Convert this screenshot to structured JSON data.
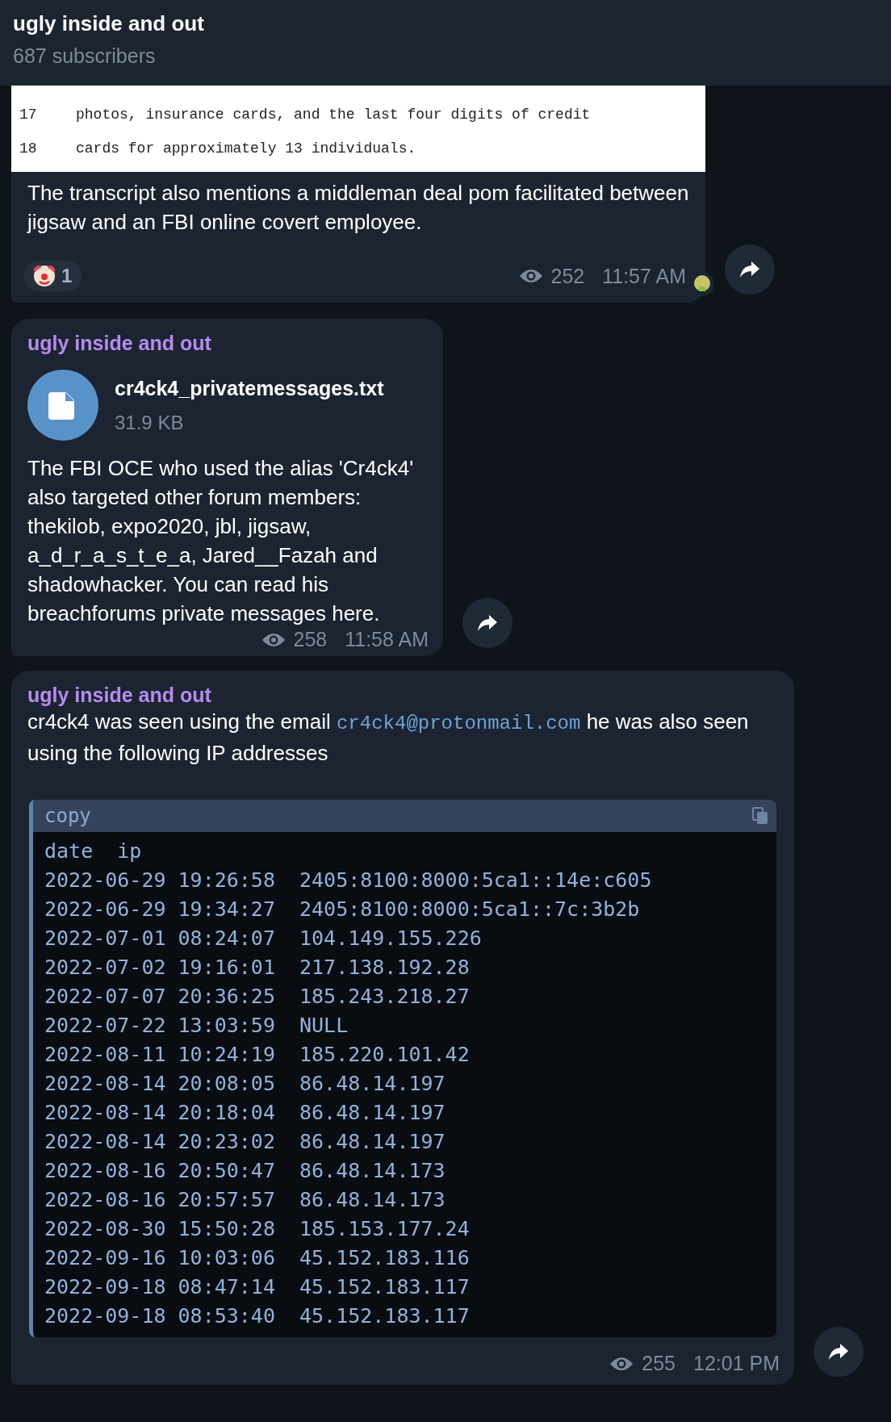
{
  "header": {
    "title": "ugly inside and out",
    "subtitle": "687 subscribers"
  },
  "messages": [
    {
      "kind": "image_text",
      "image_lines": [
        {
          "number": "17",
          "text": "photos, insurance cards, and the last four digits of credit"
        },
        {
          "number": "18",
          "text": "cards for approximately 13 individuals."
        }
      ],
      "text": "The transcript also mentions a middleman deal pom facilitated between jigsaw and an FBI online covert employee.",
      "reactions": [
        {
          "count": "1"
        }
      ],
      "views": "252",
      "time": "11:57 AM"
    },
    {
      "kind": "file",
      "sender": "ugly inside and out",
      "file": {
        "name": "cr4ck4_privatemessages.txt",
        "size": "31.9 KB"
      },
      "text": "The FBI OCE who used the alias 'Cr4ck4' also targeted other forum members: thekilob, expo2020, jbl, jigsaw, a_d_r_a_s_t_e_a, Jared__Fazah and shadowhacker. You can read his breachforums private messages here.",
      "views": "258",
      "time": "11:58 AM"
    },
    {
      "kind": "code",
      "sender": "ugly inside and out",
      "parts": [
        {
          "kind": "text",
          "text": "cr4ck4 was seen using the email "
        },
        {
          "kind": "link",
          "text": "cr4ck4@protonmail.com"
        },
        {
          "kind": "text",
          "text": " he was also seen using the following IP addresses"
        }
      ],
      "code": {
        "label": "copy",
        "columns": [
          "date",
          "ip"
        ],
        "rows": [
          {
            "date": "2022-06-29 19:26:58",
            "ip": "2405:8100:8000:5ca1::14e:c605"
          },
          {
            "date": "2022-06-29 19:34:27",
            "ip": "2405:8100:8000:5ca1::7c:3b2b"
          },
          {
            "date": "2022-07-01 08:24:07",
            "ip": "104.149.155.226"
          },
          {
            "date": "2022-07-02 19:16:01",
            "ip": "217.138.192.28"
          },
          {
            "date": "2022-07-07 20:36:25",
            "ip": "185.243.218.27"
          },
          {
            "date": "2022-07-22 13:03:59",
            "ip": "NULL"
          },
          {
            "date": "2022-08-11 10:24:19",
            "ip": "185.220.101.42"
          },
          {
            "date": "2022-08-14 20:08:05",
            "ip": "86.48.14.197"
          },
          {
            "date": "2022-08-14 20:18:04",
            "ip": "86.48.14.197"
          },
          {
            "date": "2022-08-14 20:23:02",
            "ip": "86.48.14.197"
          },
          {
            "date": "2022-08-16 20:50:47",
            "ip": "86.48.14.173"
          },
          {
            "date": "2022-08-16 20:57:57",
            "ip": "86.48.14.173"
          },
          {
            "date": "2022-08-30 15:50:28",
            "ip": "185.153.177.24"
          },
          {
            "date": "2022-09-16 10:03:06",
            "ip": "45.152.183.116"
          },
          {
            "date": "2022-09-18 08:47:14",
            "ip": "45.152.183.117"
          },
          {
            "date": "2022-09-18 08:53:40",
            "ip": "45.152.183.117"
          }
        ]
      },
      "views": "255",
      "time": "12:01 PM"
    }
  ]
}
